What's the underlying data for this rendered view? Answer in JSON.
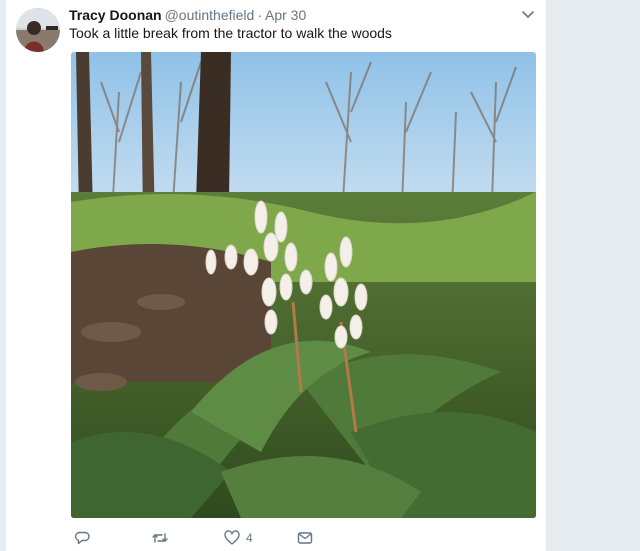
{
  "tweet": {
    "author_name": "Tracy Doonan",
    "handle": "@outinthefield",
    "separator": "·",
    "date": "Apr 30",
    "text": "Took a little break from the tractor to walk the woods",
    "image_icon": "photo-woodland-flowers",
    "actions": {
      "reply_icon": "reply-icon",
      "retweet_icon": "retweet-icon",
      "like_icon": "heart-icon",
      "like_count": "4",
      "dm_icon": "envelope-icon"
    }
  },
  "colors": {
    "background": "#e6ecf0",
    "card": "#ffffff",
    "primary_text": "#14171a",
    "secondary_text": "#657786"
  }
}
